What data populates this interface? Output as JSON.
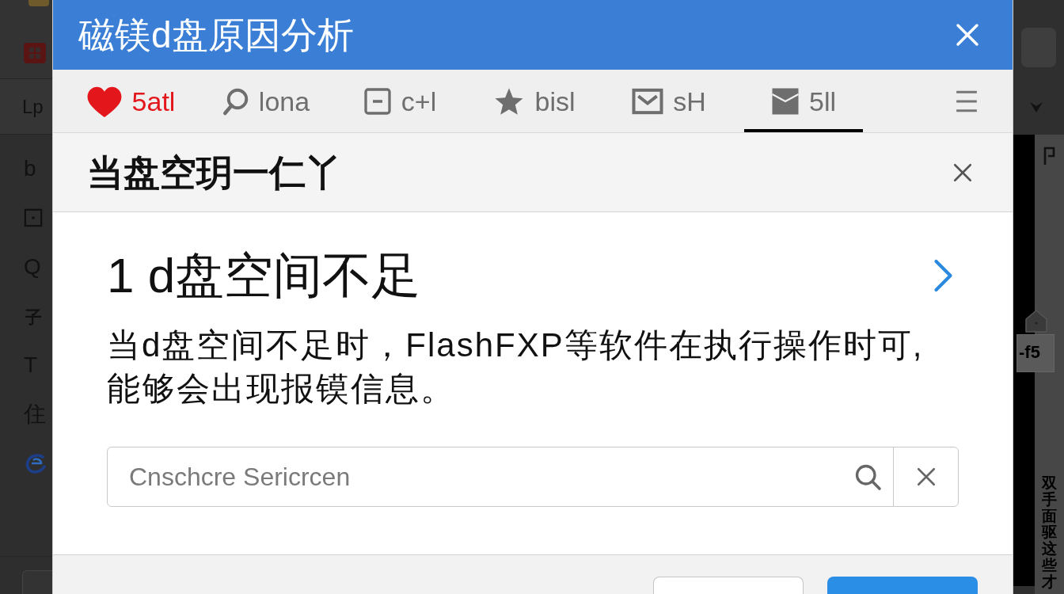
{
  "backdrop": {
    "left_rail": {
      "label": "Lp",
      "items": [
        {
          "kind": "text",
          "label": "b"
        },
        {
          "kind": "box"
        },
        {
          "kind": "text",
          "label": "Q"
        },
        {
          "kind": "hook"
        },
        {
          "kind": "text",
          "label": "T"
        },
        {
          "kind": "text",
          "label": "住"
        },
        {
          "kind": "logo"
        }
      ]
    },
    "right_rail": {
      "label": "-f5",
      "vertical_text": "双手面驱这些才"
    }
  },
  "dialog": {
    "title": "磁镁d盘原因分析",
    "tabs": [
      {
        "kind": "heart",
        "label": "5atl",
        "color": "#e3161c",
        "selected": false
      },
      {
        "kind": "search",
        "label": "lona",
        "color": "#6e6e6e",
        "selected": false
      },
      {
        "kind": "minus",
        "label": "c+l",
        "color": "#6e6e6e",
        "selected": false
      },
      {
        "kind": "star",
        "label": "bisl",
        "color": "#6e6e6e",
        "selected": false
      },
      {
        "kind": "mail",
        "label": "sH",
        "color": "#6e6e6e",
        "selected": false
      },
      {
        "kind": "mailfilled",
        "label": "5ll",
        "color": "#6e6e6e",
        "selected": true
      }
    ],
    "header": {
      "title": "当盘空玥一仁丫"
    },
    "section": {
      "heading": "1 d盘空间不足",
      "body": "当d盘空间不足时，FlashFXP等软件在执行操作时可,\n能够会出现报镆信息。"
    },
    "search": {
      "placeholder": "Cnschcre Sericrcen"
    },
    "footer": {
      "buttons": [
        {
          "kind": "secondary"
        },
        {
          "kind": "primary"
        }
      ]
    }
  }
}
